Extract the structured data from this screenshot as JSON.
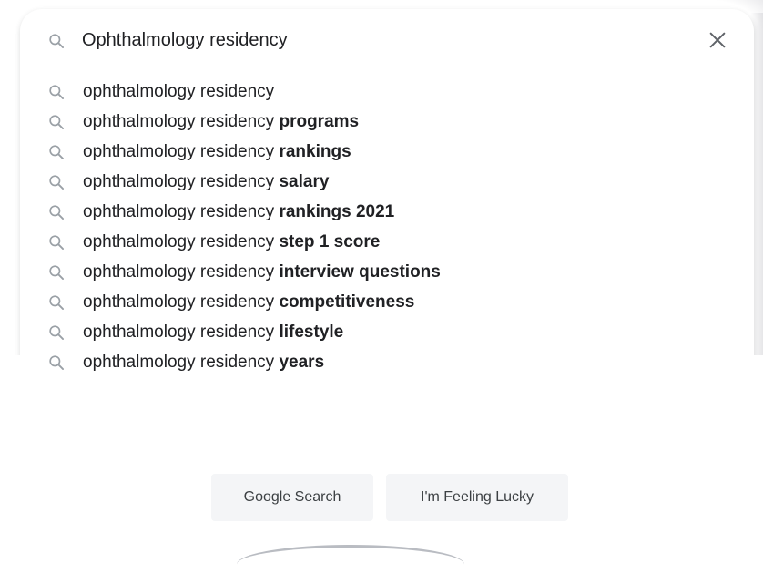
{
  "search": {
    "query": "Ophthalmology residency",
    "placeholder": "",
    "icon": "search-icon",
    "clear_icon": "close-icon"
  },
  "suggestions": [
    {
      "prefix": "ophthalmology residency",
      "bold": ""
    },
    {
      "prefix": "ophthalmology residency ",
      "bold": "programs"
    },
    {
      "prefix": "ophthalmology residency ",
      "bold": "rankings"
    },
    {
      "prefix": "ophthalmology residency ",
      "bold": "salary"
    },
    {
      "prefix": "ophthalmology residency ",
      "bold": "rankings 2021"
    },
    {
      "prefix": "ophthalmology residency ",
      "bold": "step 1 score"
    },
    {
      "prefix": "ophthalmology residency ",
      "bold": "interview questions"
    },
    {
      "prefix": "ophthalmology residency ",
      "bold": "competitiveness"
    },
    {
      "prefix": "ophthalmology residency ",
      "bold": "lifestyle"
    },
    {
      "prefix": "ophthalmology residency ",
      "bold": "years"
    }
  ],
  "buttons": {
    "google_search": "Google Search",
    "feeling_lucky": "I'm Feeling Lucky"
  },
  "colors": {
    "text": "#202124",
    "icon": "#9aa0a6",
    "button_bg": "#f4f5f7"
  }
}
